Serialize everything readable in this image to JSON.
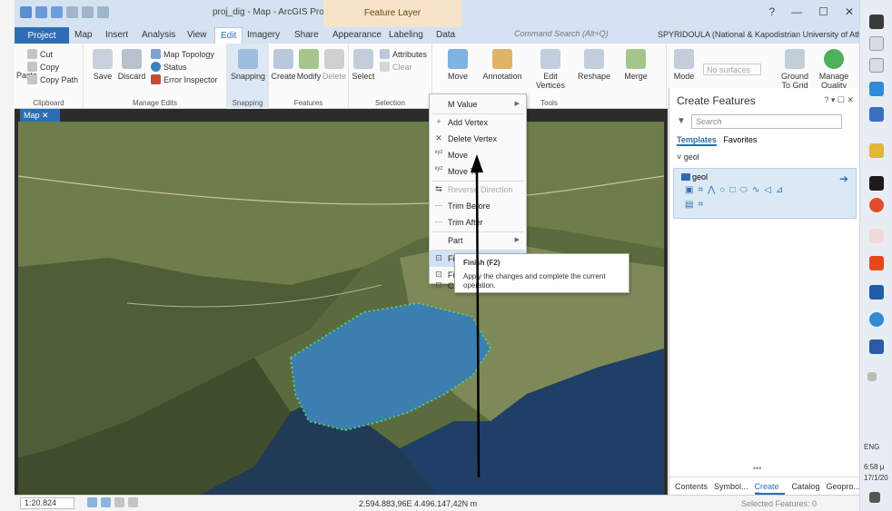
{
  "window": {
    "document_title": "proj_dig - Map - ArcGIS Pro",
    "context_tab": "Feature Layer",
    "controls": [
      "?",
      "—",
      "☐",
      "✕"
    ]
  },
  "tabs": [
    "Project",
    "Map",
    "Insert",
    "Analysis",
    "View",
    "Edit",
    "Imagery",
    "Share",
    "Appearance",
    "Labeling",
    "Data"
  ],
  "command_search": {
    "placeholder": "Command Search (Alt+Q)"
  },
  "user": "SPYRIDOULA (National & Kapodistrian University of Athens)",
  "ribbon": {
    "clipboard": {
      "label": "Clipboard",
      "cut": "Cut",
      "copy": "Copy",
      "paste": "Paste",
      "copy_path": "Copy Path"
    },
    "manage_edits": {
      "label": "Manage Edits",
      "save": "Save",
      "discard": "Discard",
      "map_topology": "Map Topology",
      "status": "Status",
      "error_inspector": "Error Inspector"
    },
    "snapping": {
      "label": "Snapping",
      "button": "Snapping"
    },
    "features": {
      "label": "Features",
      "create": "Create",
      "modify": "Modify",
      "delete": "Delete"
    },
    "selection": {
      "label": "Selection",
      "select": "Select",
      "attributes": "Attributes",
      "clear": "Clear"
    },
    "tools": {
      "label": "Tools",
      "move": "Move",
      "annotation": "Annotation",
      "edit_vertices": "Edit Vertices",
      "reshape": "Reshape",
      "merge": "Merge"
    },
    "elevation": {
      "mode": "Mode",
      "surface_placeholder": "No surfaces"
    },
    "corrections": {
      "ground_to_grid": "Ground To Grid",
      "manage_quality": "Manage Quality"
    }
  },
  "map": {
    "tab_label": "Map"
  },
  "context_menu": {
    "items": [
      {
        "label": "M Value",
        "glyph": "",
        "submenu": true,
        "state": "normal"
      },
      {
        "label": "Add Vertex",
        "glyph": "+",
        "submenu": false,
        "state": "normal"
      },
      {
        "label": "Delete Vertex",
        "glyph": "✕",
        "submenu": false,
        "state": "normal"
      },
      {
        "label": "Move",
        "glyph": "xyz",
        "submenu": false,
        "state": "normal"
      },
      {
        "label": "Move To",
        "glyph": "xyz",
        "submenu": false,
        "state": "normal"
      },
      {
        "label": "Reverse Direction",
        "glyph": "⇆",
        "submenu": false,
        "state": "disabled"
      },
      {
        "label": "Trim Before",
        "glyph": "⋯",
        "submenu": false,
        "state": "normal"
      },
      {
        "label": "Trim After",
        "glyph": "⋯",
        "submenu": false,
        "state": "normal"
      },
      {
        "label": "Part",
        "glyph": "",
        "submenu": true,
        "state": "normal"
      },
      {
        "label": "Finish",
        "glyph": "⊡",
        "submenu": false,
        "state": "highlighted"
      },
      {
        "label": "Fi",
        "glyph": "⊡",
        "submenu": false,
        "state": "normal"
      },
      {
        "label": "Ca",
        "glyph": "⊡",
        "submenu": false,
        "state": "normal"
      }
    ]
  },
  "tooltip": {
    "title": "Finish (F2)",
    "body": "Apply the changes and complete the current operation."
  },
  "create_features": {
    "title": "Create Features",
    "search_placeholder": "Search",
    "tabs": [
      "Templates",
      "Favorites"
    ],
    "group": "geol",
    "template_name": "geol",
    "bottom_tabs": [
      "Contents",
      "Symbol...",
      "Create F...",
      "Catalog",
      "Geopro..."
    ],
    "more": "•••"
  },
  "status_bar": {
    "scale": "1:20.824",
    "coordinates": "2.594.883,96E 4.496.147,42N m",
    "selected_features": "Selected Features: 0"
  },
  "taskbar": {
    "language": "ENG",
    "time": "6:58 μ",
    "date": "17/1/20"
  },
  "colors": {
    "brand_blue": "#2e6db4",
    "menu_highlight": "#cfe2f6",
    "lake": "#3a7fb0",
    "feature_layer_tab": "#f6e3c8"
  }
}
